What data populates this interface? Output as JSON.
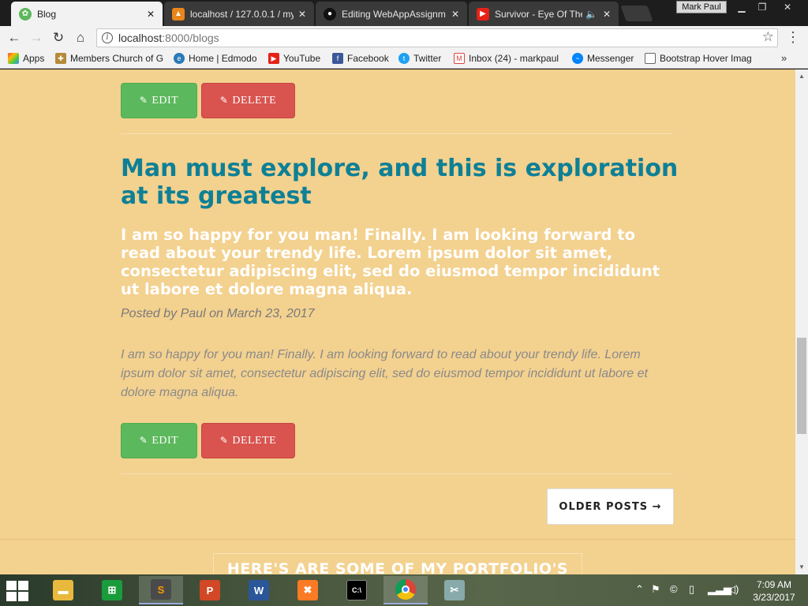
{
  "browser": {
    "tabs": [
      {
        "label": "Blog",
        "icon": "blog-leaf-icon",
        "active": true
      },
      {
        "label": "localhost / 127.0.0.1 / my",
        "icon": "phpmyadmin-icon",
        "active": false
      },
      {
        "label": "Editing WebAppAssignm",
        "icon": "github-icon",
        "active": false
      },
      {
        "label": "Survivor - Eye Of The",
        "icon": "youtube-icon",
        "active": false
      }
    ],
    "user_label": "Mark Paul",
    "address": {
      "host": "localhost",
      "path": ":8000/blogs"
    },
    "bookmarks": [
      {
        "label": "Apps",
        "icon": "apps-grid-icon"
      },
      {
        "label": "Members Church of G",
        "icon": "church-icon"
      },
      {
        "label": "Home | Edmodo",
        "icon": "edmodo-icon"
      },
      {
        "label": "YouTube",
        "icon": "youtube-icon"
      },
      {
        "label": "Facebook",
        "icon": "facebook-icon"
      },
      {
        "label": "Twitter",
        "icon": "twitter-icon"
      },
      {
        "label": "Inbox (24) - markpaul",
        "icon": "gmail-icon"
      },
      {
        "label": "Messenger",
        "icon": "messenger-icon"
      },
      {
        "label": "Bootstrap Hover Imag",
        "icon": "page-icon"
      }
    ],
    "more_bookmarks": "»"
  },
  "page": {
    "edit_label": "EDIT",
    "delete_label": "DELETE",
    "post": {
      "title": "Man must explore, and this is exploration at its greatest",
      "subtitle": "I am so happy for you man! Finally. I am looking forward to read about your trendy life. Lorem ipsum dolor sit amet, consectetur adipiscing elit, sed do eiusmod tempor incididunt ut labore et dolore magna aliqua.",
      "meta": "Posted by Paul on March 23, 2017",
      "body": "I am so happy for you man! Finally. I am looking forward to read about your trendy life. Lorem ipsum dolor sit amet, consectetur adipiscing elit, sed do eiusmod tempor incididunt ut labore et dolore magna aliqua."
    },
    "older_posts_label": "OLDER POSTS →",
    "portfolio_heading": "HERE'S ARE SOME OF MY PORTFOLIO'S",
    "colors": {
      "background": "#f3d18f",
      "title": "#0e8096",
      "edit": "#5cb85c",
      "delete": "#d9534f"
    }
  },
  "taskbar": {
    "apps": [
      {
        "name": "file-explorer-icon"
      },
      {
        "name": "store-icon"
      },
      {
        "name": "sublime-text-icon"
      },
      {
        "name": "powerpoint-icon"
      },
      {
        "name": "word-icon"
      },
      {
        "name": "xampp-icon"
      },
      {
        "name": "command-prompt-icon"
      },
      {
        "name": "chrome-icon"
      },
      {
        "name": "snipping-tool-icon"
      }
    ],
    "clock_time": "7:09 AM",
    "clock_date": "3/23/2017"
  }
}
